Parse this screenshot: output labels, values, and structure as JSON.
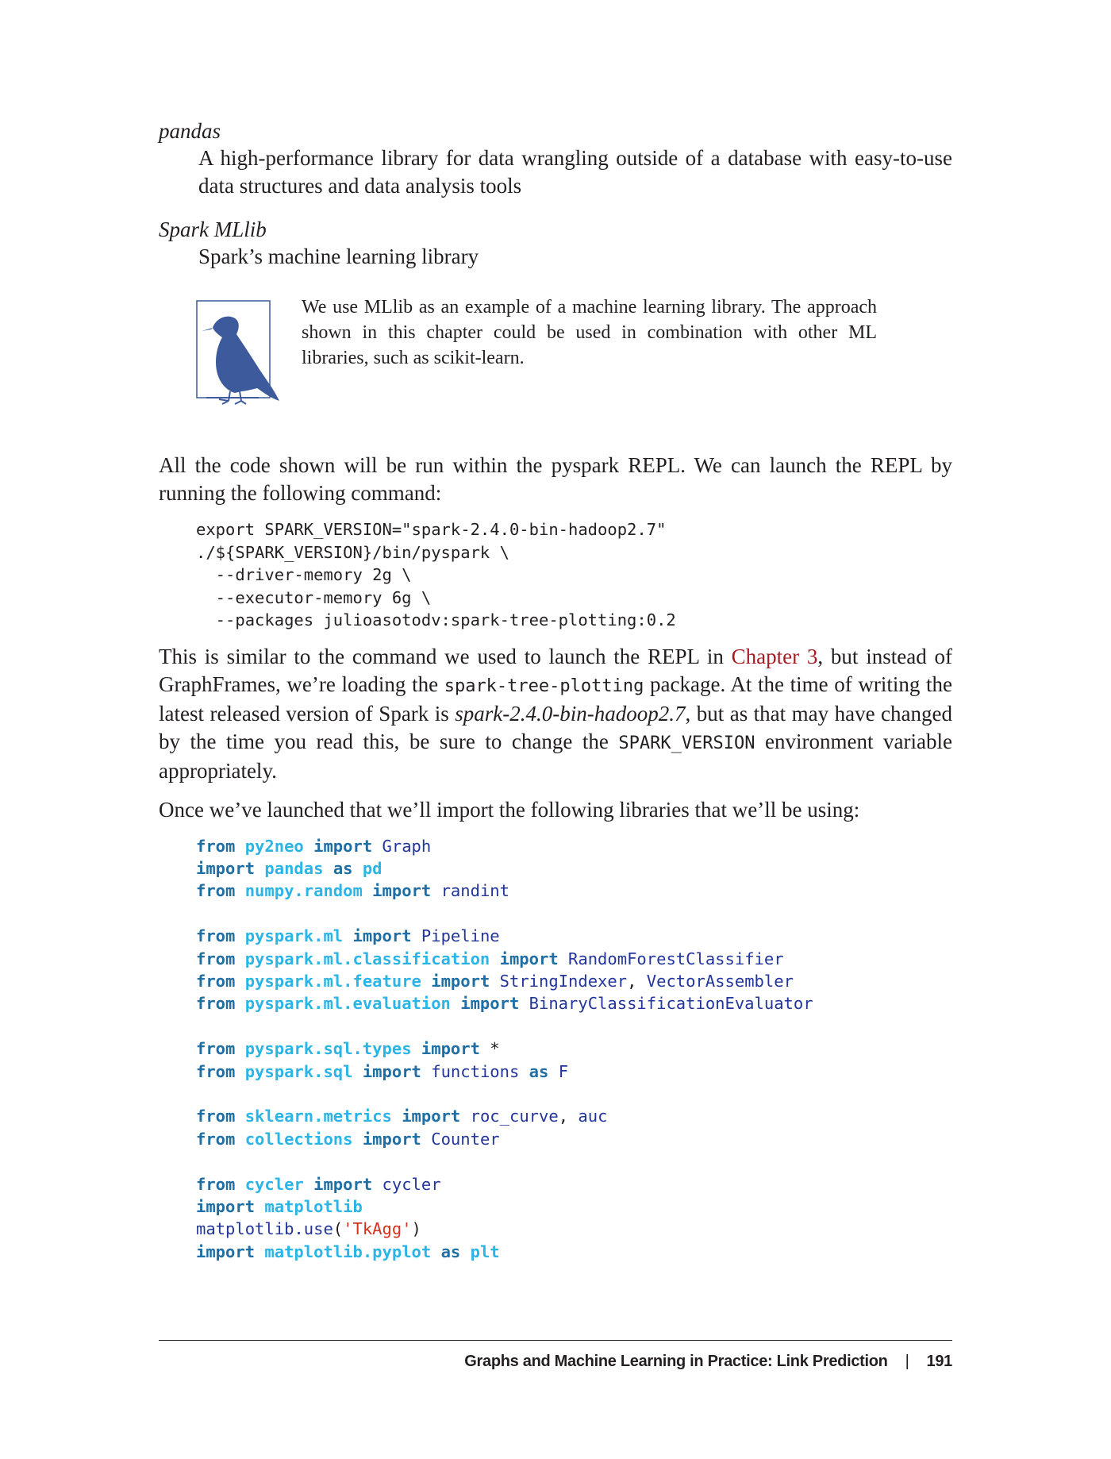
{
  "definitions": [
    {
      "term": "pandas",
      "definition": "A high-performance library for data wrangling outside of a database with easy-to-use data structures and data analysis tools"
    },
    {
      "term": "Spark MLlib",
      "definition": "Spark’s machine learning library"
    }
  ],
  "note": {
    "icon": "bird-note-icon",
    "text": "We use MLlib as an example of a machine learning library. The approach shown in this chapter could be used in combination with other ML libraries, such as scikit-learn."
  },
  "para1": "All the code shown will be run within the pyspark REPL. We can launch the REPL by running the following command:",
  "shell_code": [
    "export SPARK_VERSION=\"spark-2.4.0-bin-hadoop2.7\"",
    "./${SPARK_VERSION}/bin/pyspark \\",
    "  --driver-memory 2g \\",
    "  --executor-memory 6g \\",
    "  --packages julioasotodv:spark-tree-plotting:0.2"
  ],
  "para2": {
    "t1": "This is similar to the command we used to launch the REPL in ",
    "link": "Chapter 3",
    "t2": ", but instead of GraphFrames, we’re loading the ",
    "code1": "spark-tree-plotting",
    "t3": " package. At the time of writing the latest released version of Spark is ",
    "em1": "spark-2.4.0-bin-hadoop2.7",
    "t4": ", but as that may have changed by the time you read this, be sure to change the ",
    "code2": "SPARK_VERSION",
    "t5": " environment variable appropriately."
  },
  "para3": "Once we’ve launched that we’ll import the following libraries that we’ll be using:",
  "python_code": [
    [
      [
        "kw",
        "from"
      ],
      [
        "pl",
        " "
      ],
      [
        "mod",
        "py2neo"
      ],
      [
        "pl",
        " "
      ],
      [
        "kw",
        "import"
      ],
      [
        "pl",
        " "
      ],
      [
        "nm",
        "Graph"
      ]
    ],
    [
      [
        "kw",
        "import"
      ],
      [
        "pl",
        " "
      ],
      [
        "mod",
        "pandas"
      ],
      [
        "pl",
        " "
      ],
      [
        "kw",
        "as"
      ],
      [
        "pl",
        " "
      ],
      [
        "mod",
        "pd"
      ]
    ],
    [
      [
        "kw",
        "from"
      ],
      [
        "pl",
        " "
      ],
      [
        "mod",
        "numpy.random"
      ],
      [
        "pl",
        " "
      ],
      [
        "kw",
        "import"
      ],
      [
        "pl",
        " "
      ],
      [
        "nm",
        "randint"
      ]
    ],
    [],
    [
      [
        "kw",
        "from"
      ],
      [
        "pl",
        " "
      ],
      [
        "mod",
        "pyspark.ml"
      ],
      [
        "pl",
        " "
      ],
      [
        "kw",
        "import"
      ],
      [
        "pl",
        " "
      ],
      [
        "nm",
        "Pipeline"
      ]
    ],
    [
      [
        "kw",
        "from"
      ],
      [
        "pl",
        " "
      ],
      [
        "mod",
        "pyspark.ml.classification"
      ],
      [
        "pl",
        " "
      ],
      [
        "kw",
        "import"
      ],
      [
        "pl",
        " "
      ],
      [
        "nm",
        "RandomForestClassifier"
      ]
    ],
    [
      [
        "kw",
        "from"
      ],
      [
        "pl",
        " "
      ],
      [
        "mod",
        "pyspark.ml.feature"
      ],
      [
        "pl",
        " "
      ],
      [
        "kw",
        "import"
      ],
      [
        "pl",
        " "
      ],
      [
        "nm",
        "StringIndexer"
      ],
      [
        "pl",
        ", "
      ],
      [
        "nm",
        "VectorAssembler"
      ]
    ],
    [
      [
        "kw",
        "from"
      ],
      [
        "pl",
        " "
      ],
      [
        "mod",
        "pyspark.ml.evaluation"
      ],
      [
        "pl",
        " "
      ],
      [
        "kw",
        "import"
      ],
      [
        "pl",
        " "
      ],
      [
        "nm",
        "BinaryClassificationEvaluator"
      ]
    ],
    [],
    [
      [
        "kw",
        "from"
      ],
      [
        "pl",
        " "
      ],
      [
        "mod",
        "pyspark.sql.types"
      ],
      [
        "pl",
        " "
      ],
      [
        "kw",
        "import"
      ],
      [
        "pl",
        " *"
      ]
    ],
    [
      [
        "kw",
        "from"
      ],
      [
        "pl",
        " "
      ],
      [
        "mod",
        "pyspark.sql"
      ],
      [
        "pl",
        " "
      ],
      [
        "kw",
        "import"
      ],
      [
        "pl",
        " "
      ],
      [
        "nm",
        "functions"
      ],
      [
        "pl",
        " "
      ],
      [
        "kw",
        "as"
      ],
      [
        "pl",
        " "
      ],
      [
        "nm",
        "F"
      ]
    ],
    [],
    [
      [
        "kw",
        "from"
      ],
      [
        "pl",
        " "
      ],
      [
        "mod",
        "sklearn.metrics"
      ],
      [
        "pl",
        " "
      ],
      [
        "kw",
        "import"
      ],
      [
        "pl",
        " "
      ],
      [
        "nm",
        "roc_curve"
      ],
      [
        "pl",
        ", "
      ],
      [
        "nm",
        "auc"
      ]
    ],
    [
      [
        "kw",
        "from"
      ],
      [
        "pl",
        " "
      ],
      [
        "mod",
        "collections"
      ],
      [
        "pl",
        " "
      ],
      [
        "kw",
        "import"
      ],
      [
        "pl",
        " "
      ],
      [
        "nm",
        "Counter"
      ]
    ],
    [],
    [
      [
        "kw",
        "from"
      ],
      [
        "pl",
        " "
      ],
      [
        "mod",
        "cycler"
      ],
      [
        "pl",
        " "
      ],
      [
        "kw",
        "import"
      ],
      [
        "pl",
        " "
      ],
      [
        "nm",
        "cycler"
      ]
    ],
    [
      [
        "kw",
        "import"
      ],
      [
        "pl",
        " "
      ],
      [
        "mod",
        "matplotlib"
      ]
    ],
    [
      [
        "nm",
        "matplotlib.use"
      ],
      [
        "pl",
        "("
      ],
      [
        "str",
        "'TkAgg'"
      ],
      [
        "pl",
        ")"
      ]
    ],
    [
      [
        "kw",
        "import"
      ],
      [
        "pl",
        " "
      ],
      [
        "mod",
        "matplotlib.pyplot"
      ],
      [
        "pl",
        " "
      ],
      [
        "kw",
        "as"
      ],
      [
        "pl",
        " "
      ],
      [
        "mod",
        "plt"
      ]
    ]
  ],
  "footer": {
    "running_head": "Graphs and Machine Learning in Practice: Link Prediction",
    "separator": "|",
    "page_number": "191"
  }
}
